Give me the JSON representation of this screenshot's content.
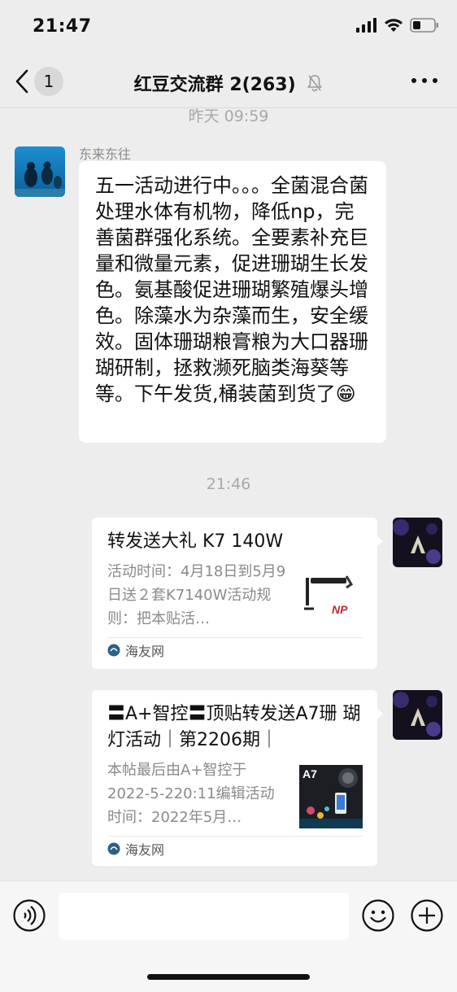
{
  "status_bar": {
    "time": "21:47"
  },
  "nav": {
    "unread_count": "1",
    "title": "红豆交流群 2(263)"
  },
  "messages": {
    "timestamp_1": "昨天 09:59",
    "sender_name": "东来东往",
    "text": "五一活动进行中。。。全菌混合菌处理水体有机物，降低np，完善菌群强化系统。全要素补充巨量和微量元素，促进珊瑚生长发色。氨基酸促进珊瑚繁殖爆头增色。除藻水为杂藻而生，安全缓效。固体珊瑚粮膏粮为大口器珊瑚研制，拯救濒死脑类海葵等等。下午发货,桶装菌到货了😁",
    "timestamp_2": "21:46"
  },
  "cards": [
    {
      "title": "转发送大礼 K7 140W",
      "desc": "活动时间：4月18日到5月9日送２套K7140W活动规则：把本贴活…",
      "source": "海友网",
      "thumb_label": "NP"
    },
    {
      "title": "〓A+智控〓顶贴转发送A7珊 瑚灯活动｜第2206期｜",
      "desc": "本帖最后由A+智控于2022-5-220:11编辑活动时间：2022年5月…",
      "source": "海友网",
      "thumb_label": "A7"
    }
  ],
  "colors": {
    "background": "#ededed",
    "bubble": "#ffffff",
    "muted_text": "#a8a8a8"
  }
}
